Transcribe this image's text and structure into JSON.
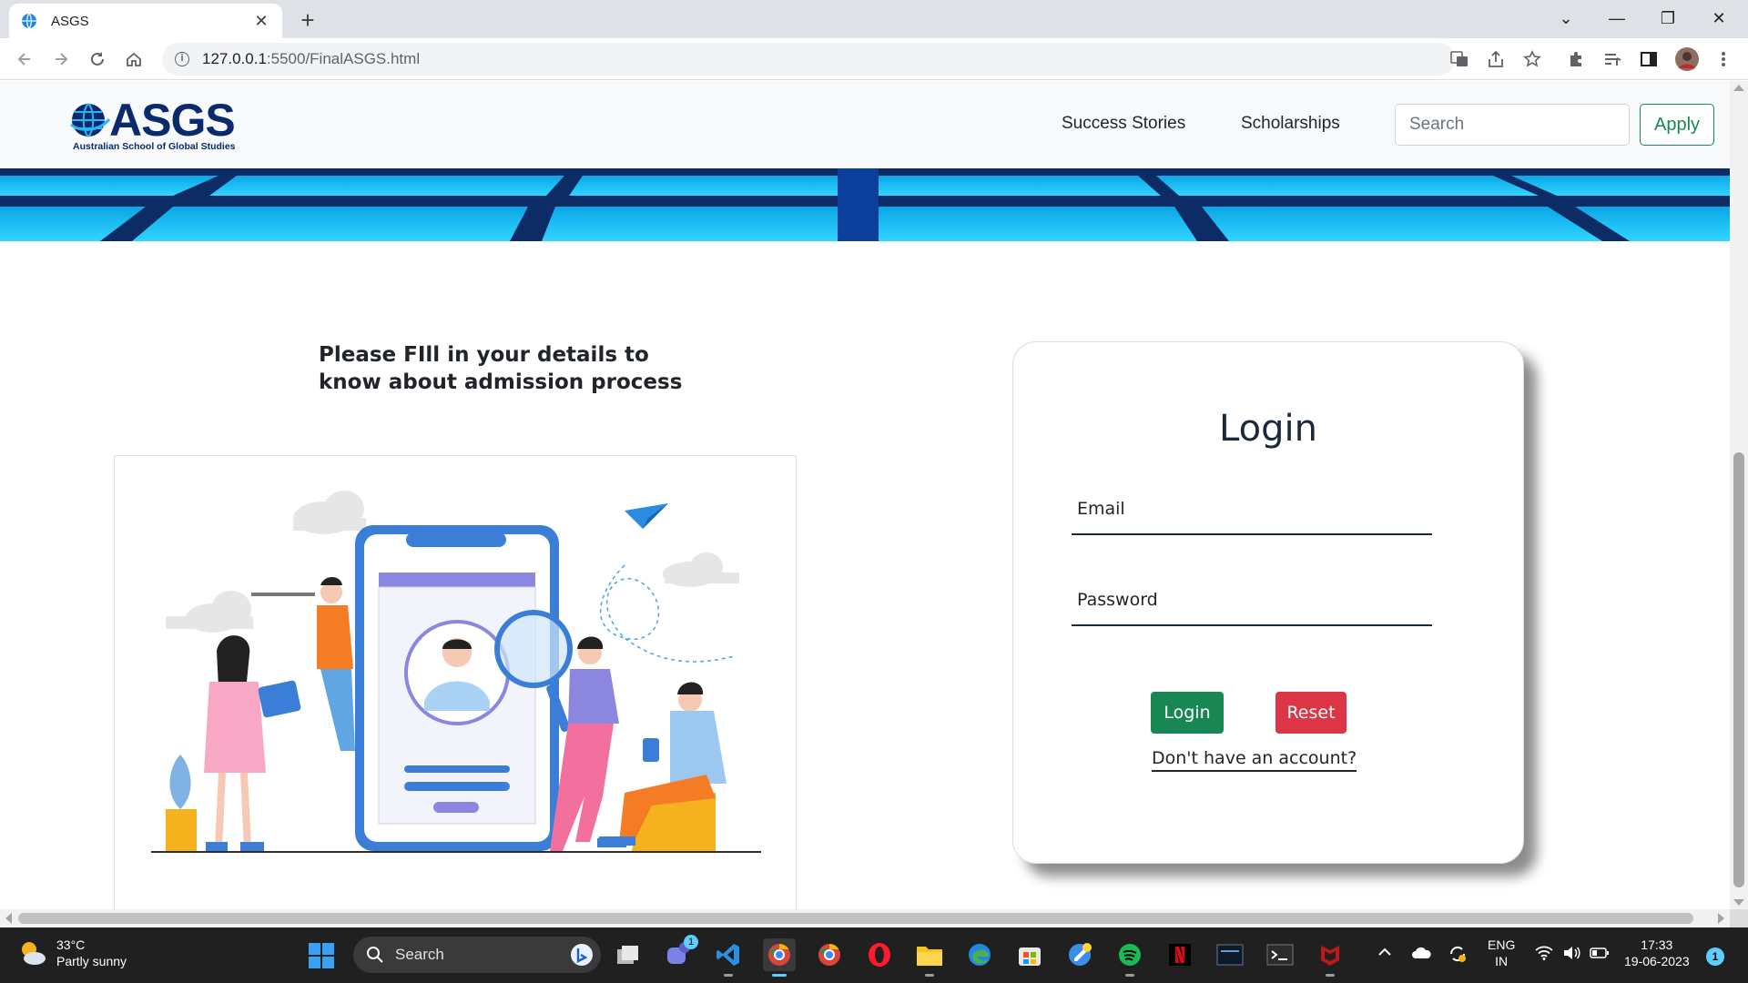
{
  "browser": {
    "tab_title": "ASGS",
    "url_host": "127.0.0.1",
    "url_path": ":5500/FinalASGS.html"
  },
  "site": {
    "logo_text": "ASGS",
    "logo_tagline": "Australian School of Global Studies",
    "nav_links": [
      "Success Stories",
      "Scholarships"
    ],
    "search_placeholder": "Search",
    "apply_label": "Apply"
  },
  "intro": {
    "heading_line1": "Please FIll in your details to",
    "heading_line2": "know about admission process"
  },
  "login": {
    "title": "Login",
    "email_label": "Email",
    "password_label": "Password",
    "login_button": "Login",
    "reset_button": "Reset",
    "signup_link": "Don't have an account?"
  },
  "taskbar": {
    "weather_temp": "33°C",
    "weather_desc": "Partly sunny",
    "search_placeholder": "Search",
    "lang_line1": "ENG",
    "lang_line2": "IN",
    "time": "17:33",
    "date": "19-06-2023",
    "notifications": "1",
    "chat_badge": "1"
  },
  "colors": {
    "brand": "#0b2a6b",
    "success": "#198754",
    "danger": "#dc3545"
  },
  "icons": [
    "globe-icon",
    "back-icon",
    "forward-icon",
    "reload-icon",
    "home-icon",
    "info-icon",
    "translate-icon",
    "share-icon",
    "star-icon",
    "extensions-icon",
    "reading-list-icon",
    "side-panel-icon",
    "profile-avatar",
    "menu-icon"
  ]
}
